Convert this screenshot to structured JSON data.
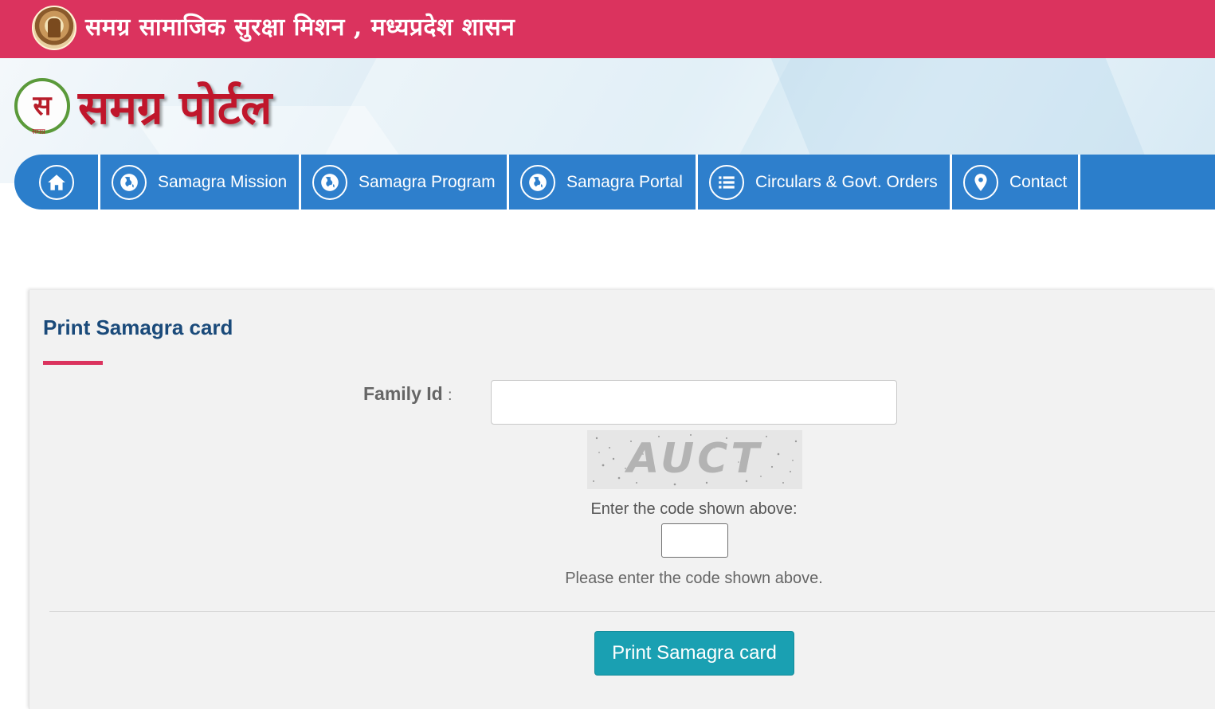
{
  "header": {
    "title": "समग्र सामाजिक सुरक्षा मिशन , मध्यप्रदेश शासन",
    "logo_caption": "समग्र",
    "portal_title": "समग्र पोर्टल",
    "logo_glyph": "स"
  },
  "nav": {
    "items": [
      {
        "label": "Samagra Mission",
        "icon": "globe-icon"
      },
      {
        "label": "Samagra Program",
        "icon": "globe-icon"
      },
      {
        "label": "Samagra Portal",
        "icon": "globe-icon"
      },
      {
        "label": "Circulars & Govt. Orders",
        "icon": "list-icon"
      },
      {
        "label": "Contact",
        "icon": "location-pin-icon"
      }
    ],
    "home_icon": "home-icon"
  },
  "form": {
    "title": "Print Samagra card",
    "family_id_label": "Family Id",
    "family_id_colon": ":",
    "family_id_value": "",
    "captcha_text": "AUCT",
    "code_label": "Enter the code shown above:",
    "code_value": "",
    "code_hint": "Please enter the code shown above.",
    "submit_label": "Print Samagra card"
  },
  "colors": {
    "topbar": "#db335e",
    "nav": "#2b7ecb",
    "title": "#1a4a7a",
    "button": "#1aa0b2"
  }
}
